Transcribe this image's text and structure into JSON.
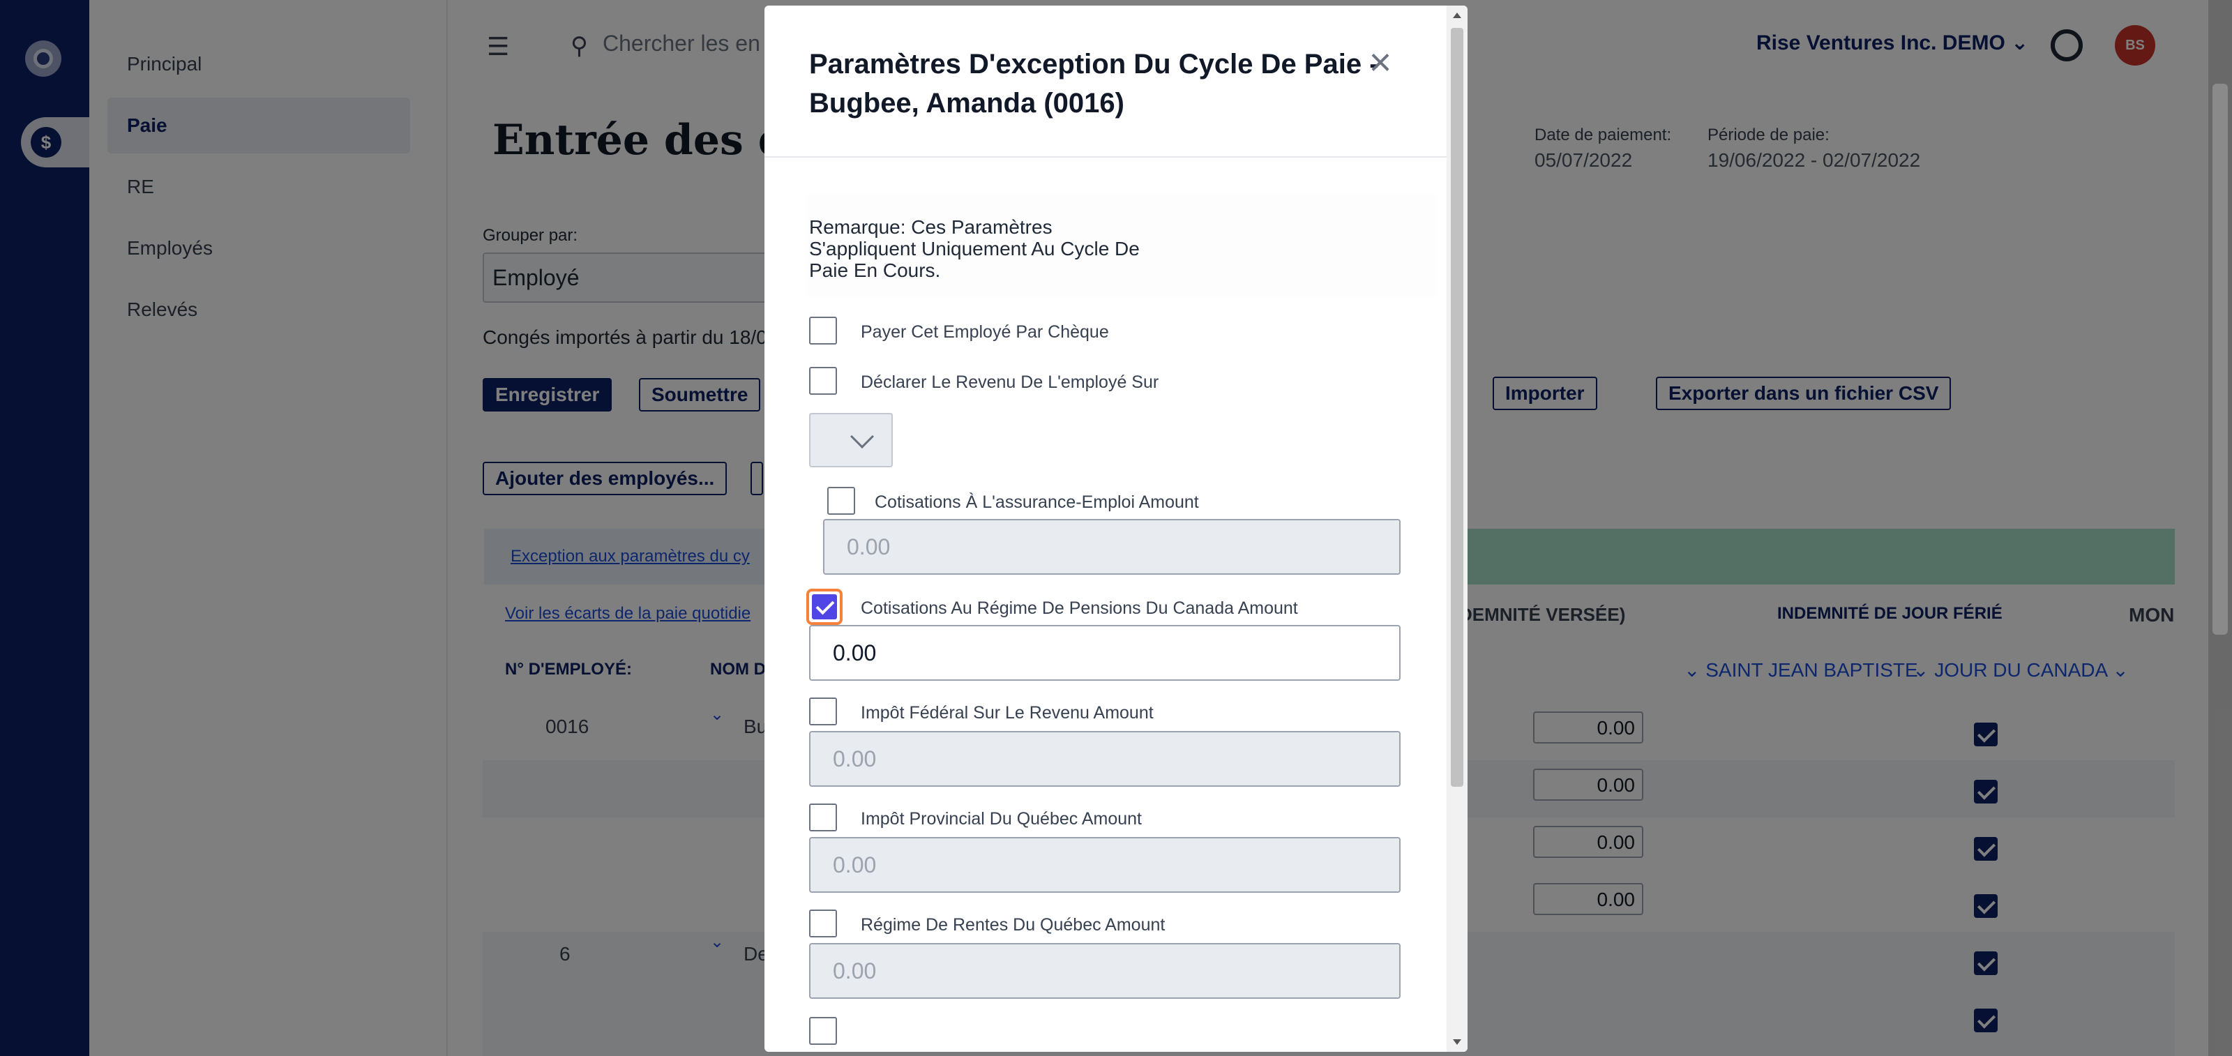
{
  "nav": {
    "items": [
      {
        "label": "Principal"
      },
      {
        "label": "Paie"
      },
      {
        "label": "RE"
      },
      {
        "label": "Employés"
      },
      {
        "label": "Relevés"
      }
    ]
  },
  "topbar": {
    "search_placeholder": "Chercher les en",
    "company": "Rise Ventures Inc. DEMO",
    "avatar_initials": "BS"
  },
  "page": {
    "title": "Entrée des do",
    "payment_date_label": "Date de paiement:",
    "payment_date": "05/07/2022",
    "pay_period_label": "Période de paie:",
    "pay_period": "19/06/2022 - 02/07/2022",
    "group_by_label": "Grouper par:",
    "group_by_value": "Employé",
    "import_note": "Congés importés à partir du 18/0"
  },
  "toolbar": {
    "save": "Enregistrer",
    "submit": "Soumettre",
    "import": "Importer",
    "export_csv": "Exporter dans un fichier CSV",
    "add_employees": "Ajouter des employés..."
  },
  "links": {
    "exception": "Exception aux paramètres du cy",
    "daily_gaps": "Voir les écarts de la paie quotidie"
  },
  "table": {
    "col_employee_no": "N° D'EMPLOYÉ:",
    "col_name": "NOM D",
    "col_indemnity_paid": "DEMNITÉ VERSÉE)",
    "col_holiday_pay": "INDEMNITÉ DE JOUR FÉRIÉ",
    "col_more": "MON",
    "sub_saint_jean": "SAINT JEAN BAPTISTE",
    "sub_canada_day": "JOUR DU CANADA",
    "rows": [
      {
        "employee_no": "0016",
        "name": "Bu"
      },
      {
        "employee_no": "6",
        "name": "De"
      }
    ],
    "amounts": [
      "0.00",
      "0.00",
      "0.00",
      "0.00"
    ]
  },
  "modal": {
    "title": "Paramètres D'exception Du Cycle De Paie -Bugbee, Amanda (0016)",
    "close_glyph": "×",
    "remark": "Remarque: Ces Paramètres S'appliquent Uniquement Au Cycle De Paie En Cours.",
    "pay_by_cheque": "Payer Cet Employé Par Chèque",
    "declare_income": "Déclarer Le Revenu De L'employé Sur",
    "ei_label": "Cotisations À L'assurance-Emploi Amount",
    "ei_value": "0.00",
    "cpp_label": "Cotisations Au Régime De Pensions Du Canada Amount",
    "cpp_value": "0.00",
    "federal_tax_label": "Impôt Fédéral Sur Le Revenu Amount",
    "federal_tax_value": "0.00",
    "quebec_tax_label": "Impôt Provincial Du Québec Amount",
    "quebec_tax_value": "0.00",
    "qpp_label": "Régime De Rentes Du Québec Amount",
    "qpp_value": "0.00"
  }
}
